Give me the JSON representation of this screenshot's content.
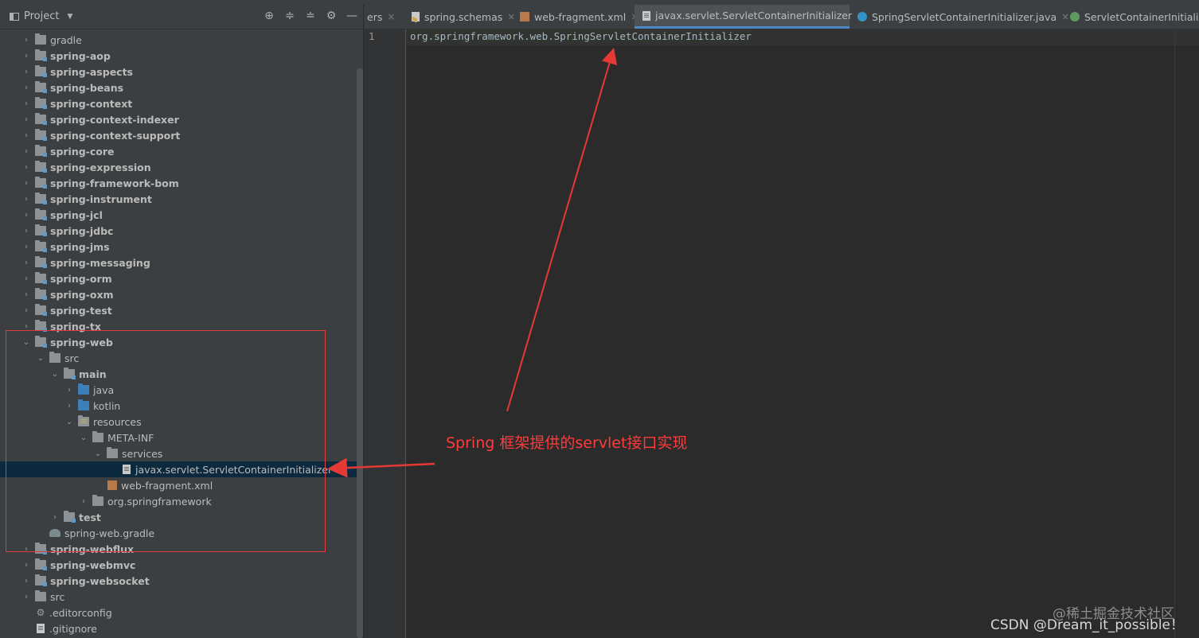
{
  "project_panel": {
    "title": "Project",
    "tools": [
      "⊕",
      "≑",
      "≐",
      "⚙",
      "—"
    ]
  },
  "tree": [
    {
      "label": "gradle",
      "arrow": "›",
      "icon": "folder",
      "bold": false
    },
    {
      "label": "spring-aop",
      "arrow": "›",
      "icon": "module",
      "bold": true
    },
    {
      "label": "spring-aspects",
      "arrow": "›",
      "icon": "module",
      "bold": true
    },
    {
      "label": "spring-beans",
      "arrow": "›",
      "icon": "module",
      "bold": true
    },
    {
      "label": "spring-context",
      "arrow": "›",
      "icon": "module",
      "bold": true
    },
    {
      "label": "spring-context-indexer",
      "arrow": "›",
      "icon": "module",
      "bold": true
    },
    {
      "label": "spring-context-support",
      "arrow": "›",
      "icon": "module",
      "bold": true
    },
    {
      "label": "spring-core",
      "arrow": "›",
      "icon": "module",
      "bold": true
    },
    {
      "label": "spring-expression",
      "arrow": "›",
      "icon": "module",
      "bold": true
    },
    {
      "label": "spring-framework-bom",
      "arrow": "›",
      "icon": "module",
      "bold": true
    },
    {
      "label": "spring-instrument",
      "arrow": "›",
      "icon": "module",
      "bold": true
    },
    {
      "label": "spring-jcl",
      "arrow": "›",
      "icon": "module",
      "bold": true
    },
    {
      "label": "spring-jdbc",
      "arrow": "›",
      "icon": "module",
      "bold": true
    },
    {
      "label": "spring-jms",
      "arrow": "›",
      "icon": "module",
      "bold": true
    },
    {
      "label": "spring-messaging",
      "arrow": "›",
      "icon": "module",
      "bold": true
    },
    {
      "label": "spring-orm",
      "arrow": "›",
      "icon": "module",
      "bold": true
    },
    {
      "label": "spring-oxm",
      "arrow": "›",
      "icon": "module",
      "bold": true
    },
    {
      "label": "spring-test",
      "arrow": "›",
      "icon": "module",
      "bold": true
    },
    {
      "label": "spring-tx",
      "arrow": "›",
      "icon": "module",
      "bold": true
    },
    {
      "label": "spring-web",
      "arrow": "⌄",
      "icon": "module",
      "bold": true
    },
    {
      "label": "src",
      "arrow": "⌄",
      "icon": "folder",
      "bold": false
    },
    {
      "label": "main",
      "arrow": "⌄",
      "icon": "module",
      "bold": true
    },
    {
      "label": "java",
      "arrow": "›",
      "icon": "blue-folder",
      "bold": false
    },
    {
      "label": "kotlin",
      "arrow": "›",
      "icon": "blue-folder",
      "bold": false
    },
    {
      "label": "resources",
      "arrow": "⌄",
      "icon": "resources-folder",
      "bold": false
    },
    {
      "label": "META-INF",
      "arrow": "⌄",
      "icon": "folder",
      "bold": false
    },
    {
      "label": "services",
      "arrow": "⌄",
      "icon": "folder",
      "bold": false
    },
    {
      "label": "javax.servlet.ServletContainerInitializer",
      "arrow": "",
      "icon": "text-file",
      "bold": false,
      "selected": true
    },
    {
      "label": "web-fragment.xml",
      "arrow": "",
      "icon": "xml-file",
      "bold": false
    },
    {
      "label": "org.springframework",
      "arrow": "›",
      "icon": "folder",
      "bold": false
    },
    {
      "label": "test",
      "arrow": "›",
      "icon": "module",
      "bold": true
    },
    {
      "label": "spring-web.gradle",
      "arrow": "",
      "icon": "gradle-file",
      "bold": false
    },
    {
      "label": "spring-webflux",
      "arrow": "›",
      "icon": "module",
      "bold": true
    },
    {
      "label": "spring-webmvc",
      "arrow": "›",
      "icon": "module",
      "bold": true
    },
    {
      "label": "spring-websocket",
      "arrow": "›",
      "icon": "module",
      "bold": true
    },
    {
      "label": "src",
      "arrow": "›",
      "icon": "folder",
      "bold": false
    },
    {
      "label": ".editorconfig",
      "arrow": "",
      "icon": "gear-file",
      "bold": false
    },
    {
      "label": ".gitignore",
      "arrow": "",
      "icon": "text-file",
      "bold": false
    }
  ],
  "tabs": [
    {
      "label": "ers",
      "icon": "",
      "active": false
    },
    {
      "label": "spring.schemas",
      "icon": "schemas-file",
      "active": false
    },
    {
      "label": "web-fragment.xml",
      "icon": "xml-file",
      "active": false
    },
    {
      "label": "javax.servlet.ServletContainerInitializer",
      "icon": "text-file",
      "active": true
    },
    {
      "label": "SpringServletContainerInitializer.java",
      "icon": "class-file",
      "active": false
    },
    {
      "label": "ServletContainerInitializer.j",
      "icon": "interface-file",
      "active": false
    }
  ],
  "tab_close": "×",
  "editor": {
    "line_number": "1",
    "code_line": "org.springframework.web.SpringServletContainerInitializer"
  },
  "annotation": {
    "text": "Spring 框架提供的servlet接口实现",
    "color": "#ff3b3b"
  },
  "watermark": {
    "line1": "@稀土掘金技术社区",
    "line2": "CSDN @Dream_it_possible！"
  },
  "colors": {
    "selection": "#0d293e",
    "annotation_red": "#e03b3b",
    "active_tab_underline": "#4a88c7"
  }
}
